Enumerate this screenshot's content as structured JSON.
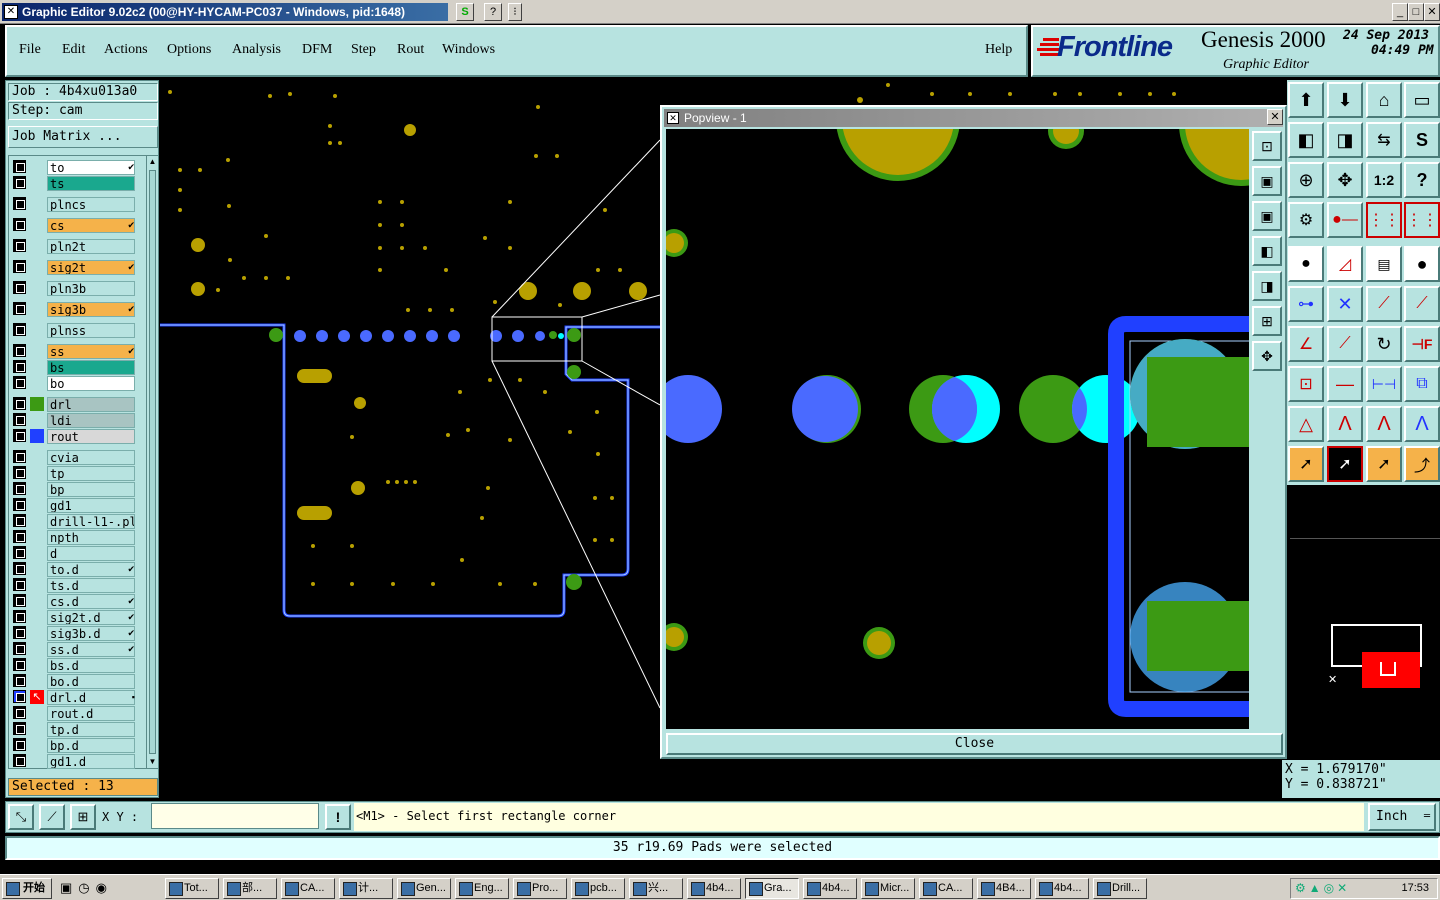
{
  "window": {
    "title": "Graphic Editor 9.02c2 (00@HY-HYCAM-PC037 - Windows, pid:1648)"
  },
  "menu": {
    "items": [
      "File",
      "Edit",
      "Actions",
      "Options",
      "Analysis",
      "DFM",
      "Step",
      "Rout",
      "Windows"
    ],
    "help": "Help"
  },
  "brand": {
    "logo": "Frontline",
    "product": "Genesis 2000",
    "subtitle": "Graphic Editor",
    "date": "24 Sep 2013",
    "time": "04:49 PM"
  },
  "job": {
    "label": "Job : 4b4xu013a0",
    "step": "Step: cam",
    "matrix_button": "Job Matrix ..."
  },
  "layers": [
    {
      "name": "to",
      "color": "#ffffff",
      "mark": "✔"
    },
    {
      "name": "ts",
      "color": "#1aa88e",
      "mark": ""
    },
    {
      "name": "plncs",
      "color": "#b7e3e0",
      "mark": ""
    },
    {
      "name": "cs",
      "color": "#f5b24a",
      "mark": "✔"
    },
    {
      "name": "pln2t",
      "color": "#b7e3e0",
      "mark": ""
    },
    {
      "name": "sig2t",
      "color": "#f5b24a",
      "mark": "✔"
    },
    {
      "name": "pln3b",
      "color": "#b7e3e0",
      "mark": ""
    },
    {
      "name": "sig3b",
      "color": "#f5b24a",
      "mark": "✔"
    },
    {
      "name": "plnss",
      "color": "#b7e3e0",
      "mark": ""
    },
    {
      "name": "ss",
      "color": "#f5b24a",
      "mark": "✔"
    },
    {
      "name": "bs",
      "color": "#1aa88e",
      "mark": ""
    },
    {
      "name": "bo",
      "color": "#ffffff",
      "mark": ""
    },
    {
      "name": "drl",
      "color": "#a8c4c2",
      "mark": ""
    },
    {
      "name": "ldi",
      "color": "#a8c4c2",
      "mark": ""
    },
    {
      "name": "rout",
      "color": "#d8d8d8",
      "mark": ""
    },
    {
      "name": "cvia",
      "color": "#b7e3e0",
      "mark": ""
    },
    {
      "name": "tp",
      "color": "#b7e3e0",
      "mark": ""
    },
    {
      "name": "bp",
      "color": "#b7e3e0",
      "mark": ""
    },
    {
      "name": "gd1",
      "color": "#b7e3e0",
      "mark": ""
    },
    {
      "name": "drill-l1-.pl",
      "color": "#b7e3e0",
      "mark": ""
    },
    {
      "name": "npth",
      "color": "#b7e3e0",
      "mark": ""
    },
    {
      "name": "d",
      "color": "#b7e3e0",
      "mark": ""
    },
    {
      "name": "to.d",
      "color": "#b7e3e0",
      "mark": "✔"
    },
    {
      "name": "ts.d",
      "color": "#b7e3e0",
      "mark": ""
    },
    {
      "name": "cs.d",
      "color": "#b7e3e0",
      "mark": "✔"
    },
    {
      "name": "sig2t.d",
      "color": "#b7e3e0",
      "mark": "✔"
    },
    {
      "name": "sig3b.d",
      "color": "#b7e3e0",
      "mark": "✔"
    },
    {
      "name": "ss.d",
      "color": "#b7e3e0",
      "mark": "✔"
    },
    {
      "name": "bs.d",
      "color": "#b7e3e0",
      "mark": ""
    },
    {
      "name": "bo.d",
      "color": "#b7e3e0",
      "mark": ""
    },
    {
      "name": "drl.d",
      "color": "#b7e3e0",
      "mark": "▪"
    },
    {
      "name": "rout.d",
      "color": "#b7e3e0",
      "mark": ""
    },
    {
      "name": "tp.d",
      "color": "#b7e3e0",
      "mark": ""
    },
    {
      "name": "bp.d",
      "color": "#b7e3e0",
      "mark": ""
    },
    {
      "name": "gd1.d",
      "color": "#b7e3e0",
      "mark": ""
    }
  ],
  "selected": "Selected : 13",
  "popview": {
    "title": "Popview - 1",
    "close": "Close"
  },
  "coords": {
    "x": "X = 1.679170\"",
    "y": "Y = 0.838721\""
  },
  "command": {
    "xy_label": "X Y :",
    "xy_value": "",
    "prompt": "<M1> - Select first rectangle corner",
    "units": "Inch"
  },
  "status": "35 r19.69 Pads were selected",
  "taskbar": {
    "start": "开始",
    "clock": "17:53",
    "tasks": [
      "Tot...",
      "部...",
      "CA...",
      "计...",
      "Gen...",
      "Eng...",
      "Pro...",
      "pcb...",
      "兴...",
      "4b4...",
      "Gra...",
      "4b4...",
      "Micr...",
      "CA...",
      "4B4...",
      "4b4...",
      "Drill..."
    ]
  },
  "colors": {
    "panel": "#b7e3e0",
    "pad": "#b8a000",
    "blue": "#2040ff",
    "green": "#3c9a14",
    "cyan": "#00ffff"
  }
}
